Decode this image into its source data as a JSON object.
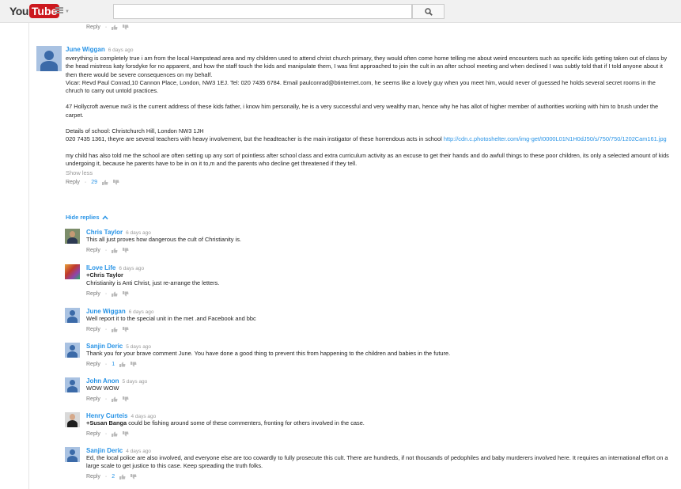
{
  "header": {
    "logo_you": "You",
    "logo_tube": "Tube",
    "search_value": ""
  },
  "top_actions": {
    "reply": "Reply"
  },
  "main_comment": {
    "author": "June Wiggan",
    "time": "6 days ago",
    "paragraphs": {
      "p1": "everything is completely true i am from the local Hampstead area and my children used to attend christ church primary, they would often come home telling me about weird encounters such as specific kids getting taken out of class by the head mistress katy forsdyke for no apparent, and how the staff touch the kids and manipulate them, I was first approached to join the cult in an after school meeting and when declined I was subtly told that if I told anyone about it then there would be severe consequences on my behalf.",
      "p1b": "Vicar: Revd Paul Conrad,10 Cannon Place, London, NW3 1EJ. Tel: 020 7435 6784. Email paulconrad@btinternet.com, he seems like a lovely guy when you meet him, would never of guessed he holds several secret rooms in the chruch to carry out untold practices.",
      "p2": "47 Hollycroft avenue nw3  is the current address of these kids father, i know him personally, he is a very successful and very wealthy man, hence why he has allot of higher member of authorities working with him to brush under the carpet.",
      "p3a": "Details of school: Christchurch Hill, London NW3 1JH",
      "p3b": "020 7435 1361, theyre are several teachers with heavy involvement, but the headteacher is the main instigator of these horrendous acts in school ",
      "p3link": "http://cdn.c.photoshelter.com/img-get/I0000L01N1H0dJ50/s/750/750/1202Cam161.jpg",
      "p4": "my child has also told me the school are often setting up any sort of pointless after school class and extra curriculum activity as an excuse to get their hands and do awfull things to these poor children, its only a selected amount of kids undergoing it, because he parents have to be in on it to,m and the parents who decline get threatened if they tell."
    },
    "show_less": "Show less",
    "reply": "Reply",
    "likes": "29"
  },
  "hide_replies": "Hide replies",
  "replies": [
    {
      "author": "Chris Taylor",
      "time": "6 days ago",
      "mention": "",
      "text": "This all just proves how dangerous the cult of Christianity is.",
      "reply": "Reply",
      "likes": ""
    },
    {
      "author": "ILove Life",
      "time": "6 days ago",
      "mention": "+Chris Taylor",
      "text": "Christianity is Anti Christ, just re-arrange the letters.",
      "reply": "Reply",
      "likes": ""
    },
    {
      "author": "June Wiggan",
      "time": "6 days ago",
      "mention": "",
      "text": "Well report it to the special unit in the met .and Facebook and bbc",
      "reply": "Reply",
      "likes": ""
    },
    {
      "author": "Sanjin Deric",
      "time": "5 days ago",
      "mention": "",
      "text": "Thank you for your brave comment June. You have done a good thing to prevent this from happening to the children and babies in the future.",
      "reply": "Reply",
      "likes": "1"
    },
    {
      "author": "John Anon",
      "time": "5 days ago",
      "mention": "",
      "text": "WOW WOW",
      "reply": "Reply",
      "likes": ""
    },
    {
      "author": "Henry Curteis",
      "time": "4 days ago",
      "mention": "+Susan Banga",
      "text": " could be fishing around some of these commenters, fronting for others involved in the case.",
      "reply": "Reply",
      "likes": ""
    },
    {
      "author": "Sanjin Deric",
      "time": "4 days ago",
      "mention": "",
      "text": "Ed, the local police are also involved, and everyone else are too cowardly to fully prosecute this cult. There are hundreds, if not thousands of pedophiles and baby murderers involved here. It requires an international effort on a large scale to get justice to this case. Keep spreading the truth folks.",
      "reply": "Reply",
      "likes": "2"
    }
  ],
  "colors": {
    "link": "#2793e6",
    "logo_red": "#cc181e"
  },
  "icons": {
    "search": "search-icon",
    "guide": "guide-menu-icon",
    "like": "thumbs-up-icon",
    "dislike": "thumbs-down-icon",
    "caret_up": "chevron-up-icon"
  }
}
